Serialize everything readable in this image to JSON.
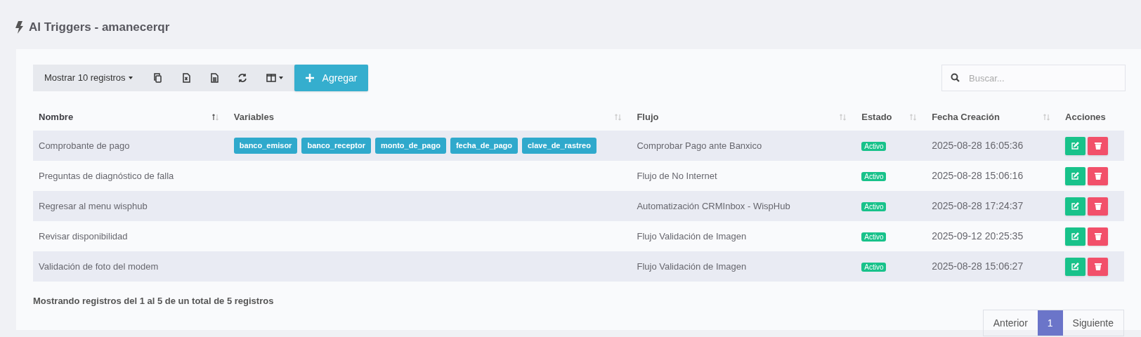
{
  "title": "AI Triggers - amanecerqr",
  "toolbar": {
    "page_length": "Mostrar 10 registros",
    "add_button": "Agregar"
  },
  "search": {
    "placeholder": "Buscar..."
  },
  "table": {
    "columns": [
      {
        "label": "Nombre",
        "sortable": true,
        "sorted": true
      },
      {
        "label": "Variables",
        "sortable": true,
        "sorted": false
      },
      {
        "label": "Flujo",
        "sortable": true,
        "sorted": false
      },
      {
        "label": "Estado",
        "sortable": true,
        "sorted": false
      },
      {
        "label": "Fecha Creación",
        "sortable": true,
        "sorted": false
      },
      {
        "label": "Acciones",
        "sortable": false,
        "sorted": false
      }
    ],
    "rows": [
      {
        "name": "Comprobante de pago",
        "variables": [
          "banco_emisor",
          "banco_receptor",
          "monto_de_pago",
          "fecha_de_pago",
          "clave_de_rastreo"
        ],
        "flow": "Comprobar Pago ante Banxico",
        "status": "Activo",
        "active": true,
        "created": "2025-08-28 16:05:36"
      },
      {
        "name": "Preguntas de diagnóstico de falla",
        "variables": [],
        "flow": "Flujo de No Internet",
        "status": "Activo",
        "active": true,
        "created": "2025-08-28 15:06:16"
      },
      {
        "name": "Regresar al menu wisphub",
        "variables": [],
        "flow": "Automatización CRMInbox - WispHub",
        "status": "Activo",
        "active": true,
        "created": "2025-08-28 17:24:37"
      },
      {
        "name": "Revisar disponibilidad",
        "variables": [],
        "flow": "Flujo Validación de Imagen",
        "status": "Activo",
        "active": true,
        "created": "2025-09-12 20:25:35"
      },
      {
        "name": "Validación de foto del modem",
        "variables": [],
        "flow": "Flujo Validación de Imagen",
        "status": "Activo",
        "active": true,
        "created": "2025-08-28 15:06:27"
      }
    ]
  },
  "info": "Mostrando registros del 1 al 5 de un total de 5 registros",
  "pagination": [
    {
      "label": "Anterior",
      "selected": false
    },
    {
      "label": "1",
      "selected": true
    },
    {
      "label": "Siguiente",
      "selected": false
    }
  ]
}
